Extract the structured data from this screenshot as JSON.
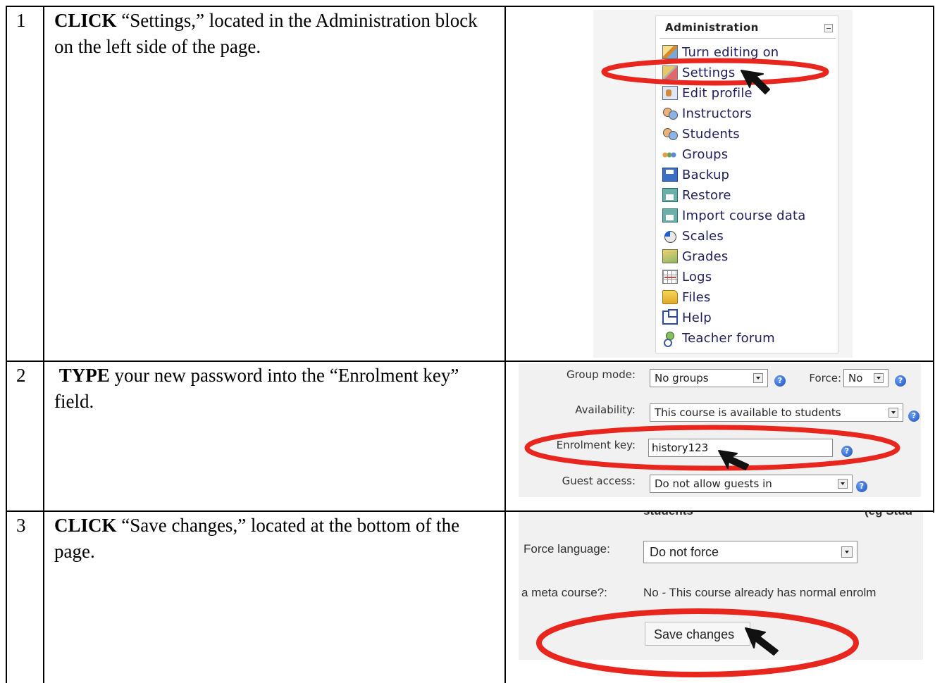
{
  "rows": [
    {
      "number": "1",
      "action": "CLICK",
      "rest": " “Settings,” located in the Administration block on the left side of the page."
    },
    {
      "number": "2",
      "action": "TYPE",
      "rest": " your new password into the “Enrolment key” field."
    },
    {
      "number": "3",
      "action": "CLICK",
      "rest": " “Save changes,” located at the bottom of the page."
    }
  ],
  "admin": {
    "title": "Administration",
    "items": [
      {
        "label": "Turn editing on",
        "icon": "pencil-icon"
      },
      {
        "label": "Settings",
        "icon": "settings-icon"
      },
      {
        "label": "Edit profile",
        "icon": "profile-icon"
      },
      {
        "label": "Instructors",
        "icon": "people-icon"
      },
      {
        "label": "Students",
        "icon": "people-icon"
      },
      {
        "label": "Groups",
        "icon": "groups-icon"
      },
      {
        "label": "Backup",
        "icon": "floppy-icon"
      },
      {
        "label": "Restore",
        "icon": "restore-icon"
      },
      {
        "label": "Import course data",
        "icon": "restore-icon"
      },
      {
        "label": "Scales",
        "icon": "scales-icon"
      },
      {
        "label": "Grades",
        "icon": "grades-icon"
      },
      {
        "label": "Logs",
        "icon": "logs-icon"
      },
      {
        "label": "Files",
        "icon": "folder-icon"
      },
      {
        "label": "Help",
        "icon": "help-icon"
      },
      {
        "label": "Teacher forum",
        "icon": "forum-icon"
      }
    ]
  },
  "form2": {
    "group_mode_label": "Group mode:",
    "group_mode_value": "No groups",
    "force_label": "Force:",
    "force_value": "No",
    "availability_label": "Availability:",
    "availability_value": "This course is available to students",
    "enrolment_key_label": "Enrolment key:",
    "enrolment_key_value": "history123",
    "guest_access_label": "Guest access:",
    "guest_access_value": "Do not allow guests in",
    "help_glyph": "?"
  },
  "form3": {
    "cut_top_left": "students",
    "cut_top_right": "(eg Stud",
    "force_language_label": "Force language:",
    "force_language_value": "Do not force",
    "meta_label": "a meta course?:",
    "meta_value": "No - This course already has normal enrolm",
    "save_button": "Save changes"
  },
  "colors": {
    "highlight_ellipse": "#e8261e",
    "form_background": "#f1f1f1",
    "link_text": "#1f1f5c"
  }
}
